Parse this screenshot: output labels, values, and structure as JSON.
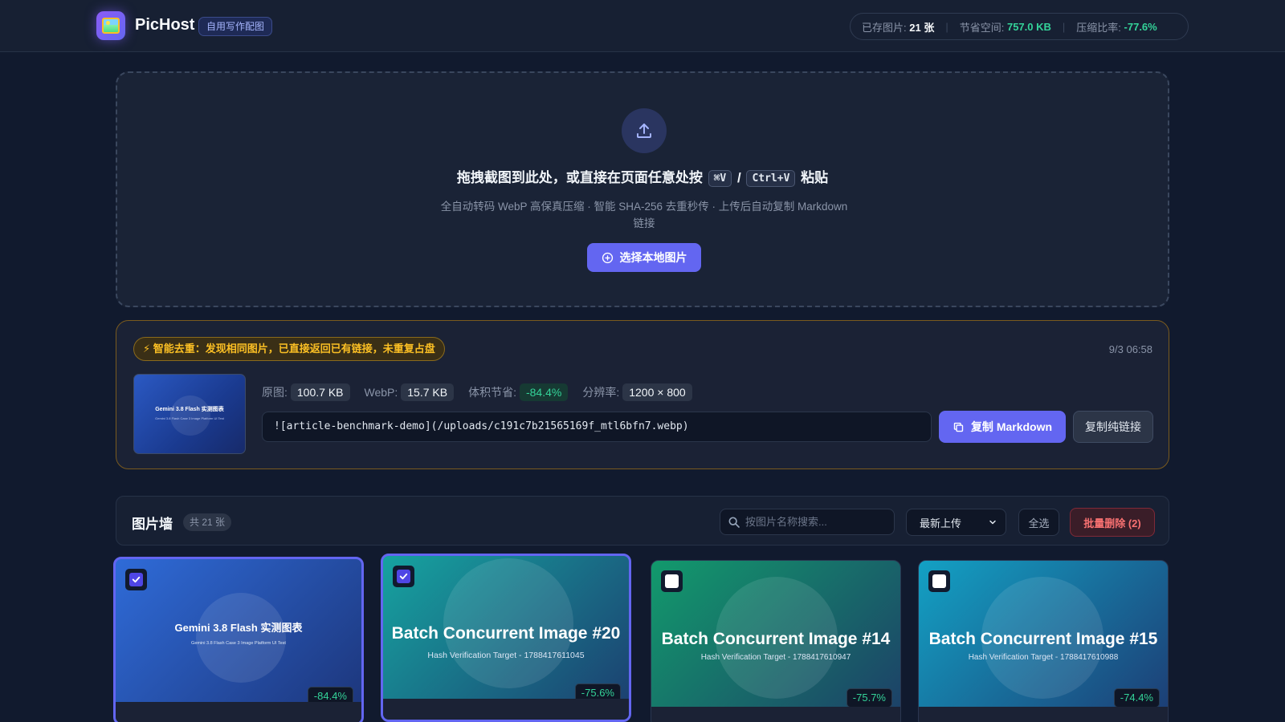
{
  "header": {
    "brand": "PicHost",
    "tag": "自用写作配图",
    "stats": {
      "stored_label": "已存图片:",
      "stored_value": "21 张",
      "saved_label": "节省空间:",
      "saved_value": "757.0 KB",
      "ratio_label": "压缩比率:",
      "ratio_value": "-77.6%"
    }
  },
  "dropzone": {
    "title_before": "拖拽截图到此处，或直接在页面任意处按",
    "key_mac": "⌘V",
    "key_sep": "/",
    "key_win": "Ctrl+V",
    "title_after": "粘贴",
    "subtitle": "全自动转码 WebP 高保真压缩 · 智能 SHA-256 去重秒传 · 上传后自动复制 Markdown 链接",
    "button_label": "选择本地图片"
  },
  "result": {
    "dedup_notice": "智能去重：发现相同图片，已直接返回已有链接，未重复占盘",
    "timestamp": "9/3 06:58",
    "thumb_title": "Gemini 3.8 Flash 实测图表",
    "thumb_sub": "Gemini 3.8 Flash Case 3 Image Platform UI Test",
    "original_label": "原图:",
    "original_value": "100.7 KB",
    "webp_label": "WebP:",
    "webp_value": "15.7 KB",
    "saving_label": "体积节省:",
    "saving_value": "-84.4%",
    "resolution_label": "分辨率:",
    "resolution_value": "1200 × 800",
    "markdown": "![article-benchmark-demo](/uploads/c191c7b21565169f_mtl6bfn7.webp)",
    "copy_md_label": "复制 Markdown",
    "copy_link_label": "复制纯链接"
  },
  "gallery": {
    "title": "图片墙",
    "count": "共 21 张",
    "search_placeholder": "按图片名称搜索...",
    "sort_value": "最新上传",
    "select_all_label": "全选",
    "bulk_delete_label": "批量删除 (2)",
    "cards": [
      {
        "title": "Gemini 3.8 Flash 实测图表",
        "sub": "Gemini 3.8 Flash Case 3 Image Platform UI Test",
        "ratio": "-84.4%",
        "checked": true,
        "color_a": "#2f6bd8",
        "color_b": "#1c3478"
      },
      {
        "title": "Batch Concurrent Image #20",
        "sub": "Hash Verification Target - 1788417611045",
        "ratio": "-75.6%",
        "checked": true,
        "color_a": "#16a3a0",
        "color_b": "#1c3c6e"
      },
      {
        "title": "Batch Concurrent Image #14",
        "sub": "Hash Verification Target - 1788417610947",
        "ratio": "-75.7%",
        "checked": false,
        "color_a": "#129a6c",
        "color_b": "#1d3d67"
      },
      {
        "title": "Batch Concurrent Image #15",
        "sub": "Hash Verification Target - 1788417610988",
        "ratio": "-74.4%",
        "checked": false,
        "color_a": "#13a1c4",
        "color_b": "#1d3a72"
      }
    ]
  }
}
